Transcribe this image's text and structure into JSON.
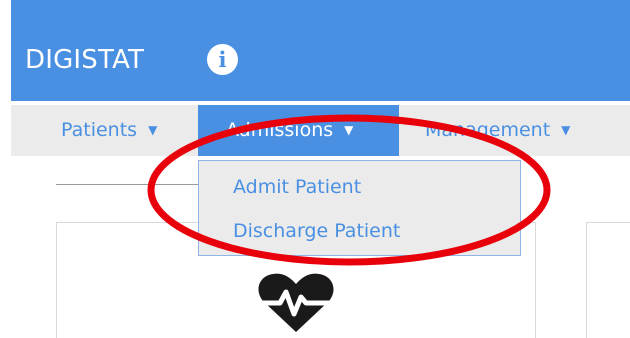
{
  "header": {
    "app_title": "DIGISTAT",
    "info_icon": "info-icon",
    "background_color": "#4a90e2"
  },
  "nav": {
    "items": [
      {
        "label": "Patients",
        "state": "default"
      },
      {
        "label": "Admissions",
        "state": "active"
      },
      {
        "label": "Management",
        "state": "default"
      }
    ],
    "caret_icon": "caret-down-icon",
    "active_color": "#4a90e2",
    "bar_color": "#ebebeb"
  },
  "admissions_menu": {
    "items": [
      {
        "label": "Admit Patient"
      },
      {
        "label": "Discharge Patient"
      }
    ]
  },
  "card": {
    "icon": "heart-pulse-icon"
  },
  "annotation": {
    "shape": "ellipse",
    "color": "#e8000b"
  }
}
